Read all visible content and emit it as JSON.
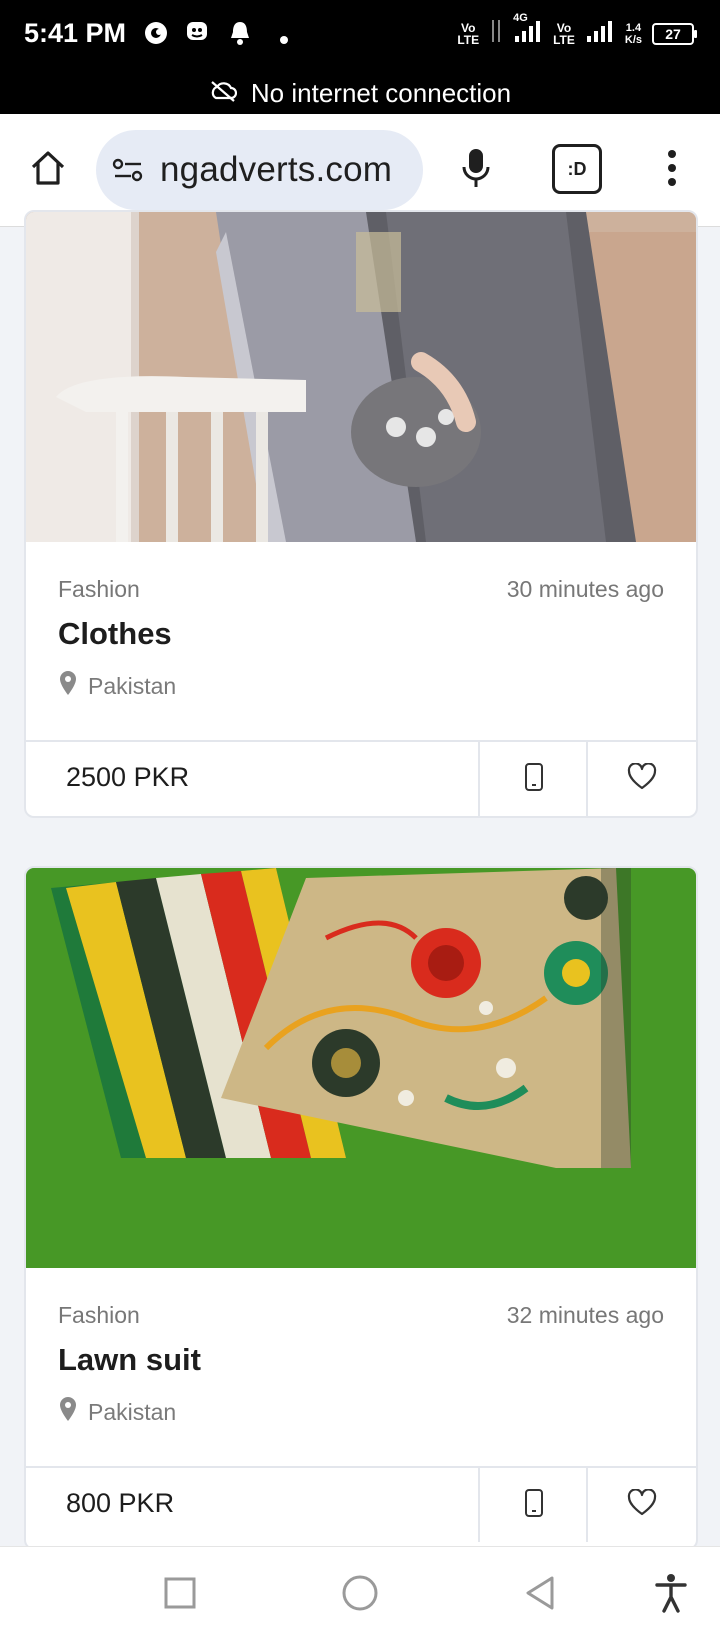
{
  "status_bar": {
    "time": "5:41 PM",
    "network1_top": "Vo",
    "network1_bottom": "LTE",
    "network2_top": "Vo",
    "network2_bottom": "LTE",
    "gen": "4G",
    "speed_value": "1.4",
    "speed_unit": "K/s",
    "battery": "27"
  },
  "offline_banner": {
    "text": "No internet connection",
    "icon": "cloud-off-icon"
  },
  "browser": {
    "url": "ngadverts.com",
    "icons": [
      "home-icon",
      "site-settings-icon",
      "mic-icon",
      "tab-switcher-icon",
      "more-vert-icon"
    ],
    "tab_label": ":D"
  },
  "listings": [
    {
      "category": "Fashion",
      "time_ago": "30 minutes ago",
      "title": "Clothes",
      "location": "Pakistan",
      "price": "2500 PKR"
    },
    {
      "category": "Fashion",
      "time_ago": "32 minutes ago",
      "title": "Lawn suit",
      "location": "Pakistan",
      "price": "800 PKR"
    }
  ],
  "colors": {
    "accent_url_bar": "#e6ebf5",
    "page_background": "#f1f3f7",
    "grass_green": "#3f8f22"
  },
  "nav_icons": [
    "recents-square-icon",
    "home-circle-icon",
    "back-triangle-icon",
    "accessibility-icon"
  ]
}
